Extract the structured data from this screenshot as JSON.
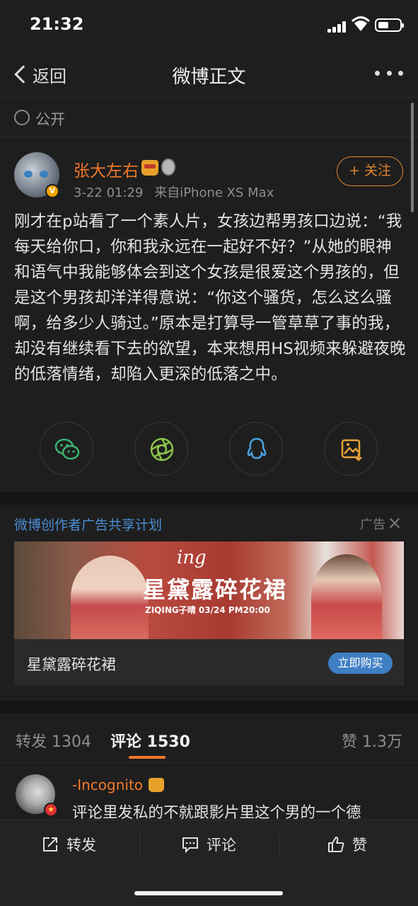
{
  "status_bar": {
    "time": "21:32"
  },
  "nav": {
    "back_label": "返回",
    "title": "微博正文"
  },
  "visibility": {
    "label": "公开"
  },
  "author": {
    "name": "张大左右",
    "badge": "V",
    "timestamp": "3-22 01:29",
    "source": "来自iPhone XS Max",
    "follow_label": "+ 关注"
  },
  "post": {
    "text": "刚才在p站看了一个素人片，女孩边帮男孩口边说：“我每天给你口，你和我永远在一起好不好？”从她的眼神和语气中我能够体会到这个女孩是很爱这个男孩的，但是这个男孩却洋洋得意说：“你这个骚货，怎么这么骚啊，给多少人骑过。”原本是打算导一管草草了事的我，却没有继续看下去的欲望，本来想用HS视频来躲避夜晚的低落情绪，却陷入更深的低落之中。"
  },
  "share": {
    "items": [
      {
        "icon": "wechat-icon",
        "color": "#3cb371"
      },
      {
        "icon": "moments-icon",
        "color": "#8bc34a"
      },
      {
        "icon": "qq-icon",
        "color": "#4aa3df"
      },
      {
        "icon": "save-image-icon",
        "color": "#e8a33a"
      }
    ]
  },
  "ad": {
    "program": "微博创作者广告共享计划",
    "tag": "广告",
    "banner_script": "ing",
    "banner_head": "星黛露碎花裙",
    "banner_sub": "ZIQING子晴 03/24 PM20:00",
    "product": "星黛露碎花裙",
    "buy_label": "立即购买"
  },
  "tabs": {
    "repost": "转发 1304",
    "comment": "评论 1530",
    "like": "赞 1.3万"
  },
  "comment": {
    "user": "-Incognito",
    "text": "评论里发私的不就跟影片里这个男的一个德"
  },
  "bottom": {
    "repost": "转发",
    "comment": "评论",
    "like": "赞"
  },
  "colors": {
    "accent": "#f27a2a",
    "link": "#4a8fd6",
    "background": "#1e1e1e"
  }
}
